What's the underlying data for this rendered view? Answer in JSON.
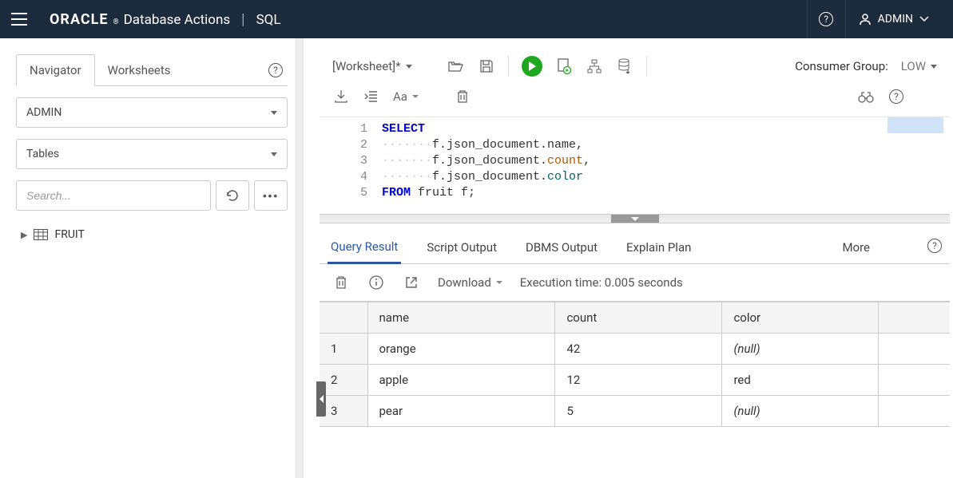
{
  "header": {
    "brand_oracle": "ORACLE",
    "brand_actions": "Database Actions",
    "brand_sql": "SQL",
    "user": "ADMIN"
  },
  "navigator": {
    "tab_navigator": "Navigator",
    "tab_worksheets": "Worksheets",
    "schema": "ADMIN",
    "object_type": "Tables",
    "search_placeholder": "Search...",
    "tree_item": "FRUIT"
  },
  "worksheet": {
    "name": "[Worksheet]*",
    "consumer_label": "Consumer Group:",
    "consumer_value": "LOW",
    "font_label": "Aa",
    "code_lines": [
      "1",
      "2",
      "3",
      "4",
      "5"
    ]
  },
  "results": {
    "tabs": {
      "query_result": "Query Result",
      "script_output": "Script Output",
      "dbms_output": "DBMS Output",
      "explain_plan": "Explain Plan",
      "more": "More"
    },
    "download_label": "Download",
    "exec_time": "Execution time: 0.005 seconds",
    "columns": [
      "name",
      "count",
      "color"
    ],
    "rows": [
      {
        "n": "1",
        "name": "orange",
        "count": "42",
        "color": null
      },
      {
        "n": "2",
        "name": "apple",
        "count": "12",
        "color": "red"
      },
      {
        "n": "3",
        "name": "pear",
        "count": "5",
        "color": null
      }
    ],
    "null_text": "(null)"
  }
}
